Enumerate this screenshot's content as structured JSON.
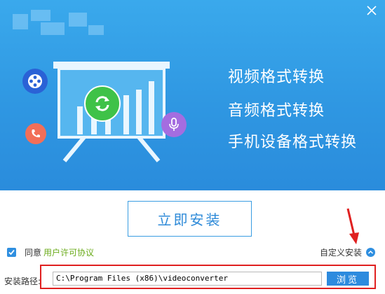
{
  "banner": {
    "features": [
      "视频格式转换",
      "音频格式转换",
      "手机设备格式转换"
    ],
    "icons": [
      "film-reel-icon",
      "sync-icon",
      "phone-icon",
      "microphone-icon",
      "presentation-board-icon"
    ]
  },
  "window": {
    "close_icon": "close-icon"
  },
  "install": {
    "label": "立即安装"
  },
  "agreement": {
    "checked": true,
    "prefix": "同意",
    "link": "用户许可协议"
  },
  "custom_install": {
    "label": "自定义安装",
    "icon": "chevron-up-icon"
  },
  "path": {
    "label": "安装路径:",
    "value": "C:\\Program Files (x86)\\videoconverter",
    "browse_label": "浏览"
  },
  "colors": {
    "brand_blue": "#2f97e2",
    "accent_green": "#3fc248",
    "link_green": "#6aab1a",
    "highlight_red": "#e02020"
  }
}
